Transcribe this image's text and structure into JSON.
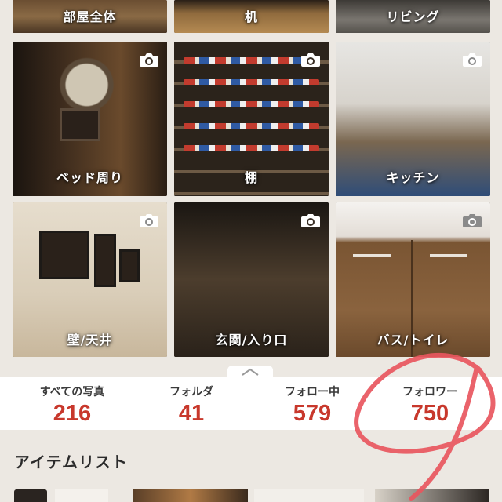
{
  "folders": [
    {
      "id": "room",
      "label": "部屋全体"
    },
    {
      "id": "desk",
      "label": "机"
    },
    {
      "id": "living",
      "label": "リビング"
    },
    {
      "id": "bed",
      "label": "ベッド周り"
    },
    {
      "id": "shelf",
      "label": "棚"
    },
    {
      "id": "kitchen",
      "label": "キッチン"
    },
    {
      "id": "wall",
      "label": "壁/天井"
    },
    {
      "id": "entrance",
      "label": "玄関/入り口"
    },
    {
      "id": "bath",
      "label": "バス/トイレ"
    }
  ],
  "stats": {
    "photos": {
      "label": "すべての写真",
      "value": "216"
    },
    "folders": {
      "label": "フォルダ",
      "value": "41"
    },
    "following": {
      "label": "フォロー中",
      "value": "579"
    },
    "followers": {
      "label": "フォロワー",
      "value": "750"
    }
  },
  "section": {
    "item_list_title": "アイテムリスト"
  },
  "colors": {
    "accent": "#c8382c",
    "annotation": "#e8565e",
    "background": "#ece8e2"
  },
  "icons": {
    "camera": "camera-icon",
    "collapse": "chevron-up-icon"
  }
}
